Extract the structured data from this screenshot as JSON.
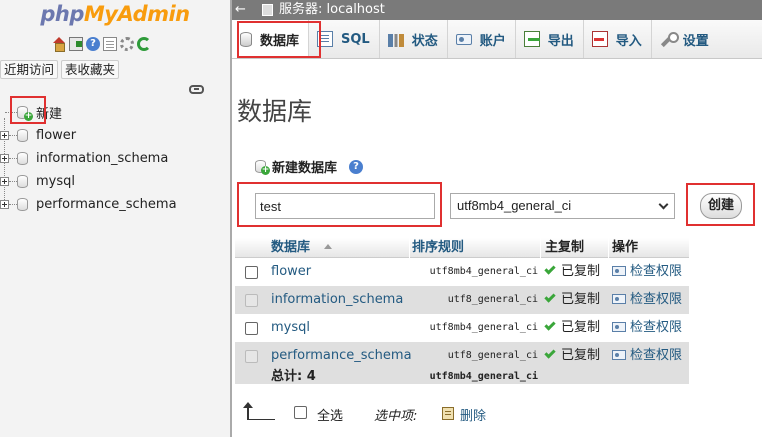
{
  "nav": {
    "logo_php": "php",
    "logo_myadmin": "MyAdmin",
    "icons": [
      "home-icon",
      "exit-icon",
      "help-icon",
      "docs-icon",
      "settings-icon",
      "reload-icon"
    ],
    "tabs": [
      "近期访问",
      "表收藏夹"
    ],
    "new_label": "新建",
    "databases": [
      "flower",
      "information_schema",
      "mysql",
      "performance_schema"
    ]
  },
  "topbar": {
    "server_label": "服务器: localhost"
  },
  "tabs": [
    {
      "label": "数据库",
      "icon": "database-icon"
    },
    {
      "label": "SQL",
      "icon": "sql-icon"
    },
    {
      "label": "状态",
      "icon": "status-icon"
    },
    {
      "label": "账户",
      "icon": "accounts-icon"
    },
    {
      "label": "导出",
      "icon": "export-icon"
    },
    {
      "label": "导入",
      "icon": "import-icon"
    },
    {
      "label": "设置",
      "icon": "wrench-icon"
    }
  ],
  "main": {
    "title": "数据库",
    "create_heading": "新建数据库",
    "help_glyph": "?",
    "db_name_value": "test",
    "collation_value": "utf8mb4_general_ci",
    "create_button": "创建"
  },
  "table": {
    "headers": {
      "name": "数据库",
      "collation": "排序规则",
      "replication": "主复制",
      "action": "操作"
    },
    "rows": [
      {
        "name": "flower",
        "collation": "utf8mb4_general_ci",
        "replication": "已复制",
        "action": "检查权限"
      },
      {
        "name": "information_schema",
        "collation": "utf8_general_ci",
        "replication": "已复制",
        "action": "检查权限"
      },
      {
        "name": "mysql",
        "collation": "utf8mb4_general_ci",
        "replication": "已复制",
        "action": "检查权限"
      },
      {
        "name": "performance_schema",
        "collation": "utf8_general_ci",
        "replication": "已复制",
        "action": "检查权限"
      }
    ],
    "total_label": "总计: 4",
    "total_collation": "utf8mb4_general_ci"
  },
  "footer": {
    "select_all": "全选",
    "with_selected": "选中项:",
    "delete": "删除"
  },
  "colors": {
    "highlight_border": "#e03030",
    "link": "#235a81",
    "logo_php": "#6c78af",
    "logo_myadmin": "#f89c0e"
  }
}
